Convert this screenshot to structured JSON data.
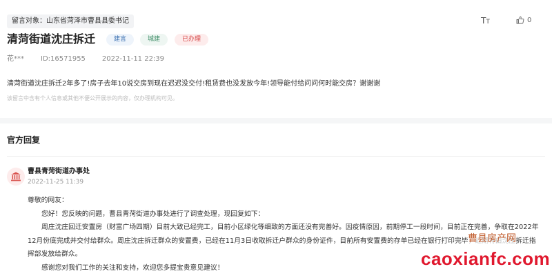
{
  "header": {
    "recipient": "留言对象：山东省菏泽市曹县县委书记",
    "font_toggle_icon": "font-size-icon",
    "like_icon": "thumbs-up-icon",
    "like_count": "0"
  },
  "post": {
    "title": "清菏街道沈庄拆迁",
    "tags": [
      "建言",
      "城建",
      "已办理"
    ],
    "author": "花***",
    "id": "ID:16571955",
    "time": "2022-11-11 22:39",
    "content": "清菏街道沈庄拆迁2年多了!房子去年10说交房到现在迟迟没交付!租赁费也没发放今年!领导能付给问问何时能交房？谢谢谢",
    "notice": "该留言中含有个人信息或其他不便公开展示的内容，仅办理机构可见。"
  },
  "reply_section": {
    "title": "官方回复",
    "avatar_icon": "government-building-icon",
    "org": "曹县青菏街道办事处",
    "time": "2022-11-25 11:39",
    "greeting": "尊敬的网友：",
    "paragraphs": [
      "您好！您反映的问题，曹县青菏街道办事处进行了调查处理，现回复如下：",
      "周庄沈庄回迁安置房（财富广场四期）目前大致已经完工，目前小区绿化等细致的方面还没有完善好。因疫情原因，前期停工一段时间，目前正在完善，争取在2022年12月份底完成并交付给群众。周庄沈庄拆迁群众的安置费，已经在11月3日收取拆迁户群众的身份证件，目前所有安置费的存单已经在银行打印完毕，近期将由沈庄拆迁指挥部发放给群众。",
      "感谢您对我们工作的关注和支持，欢迎您多提宝贵意见建议！"
    ]
  },
  "watermark": {
    "cn": "曹县房产网",
    "en": "caoxianfc.com"
  },
  "colors": {
    "tag_suggest": "#3a6fb0",
    "tag_urban": "#3d8c66",
    "tag_done": "#d64545",
    "watermark_en": "#e0182e"
  }
}
